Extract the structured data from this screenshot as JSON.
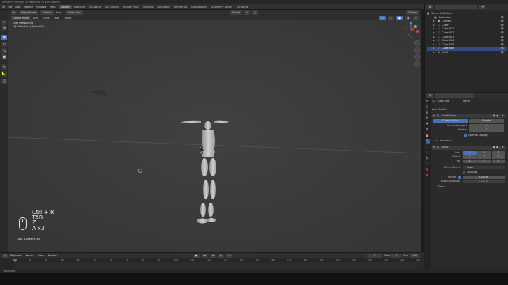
{
  "window": {
    "title": "Blender* [W:\\Rorie to learn\\how to use 1.blend]"
  },
  "menubar": {
    "menus": [
      "File",
      "Edit",
      "Render",
      "Window",
      "Help"
    ],
    "workspaces": [
      "Layout",
      "Modeling",
      "Sculpting",
      "UV Editing",
      "Texture Paint",
      "Shading",
      "Animation",
      "Rendering",
      "Compositing",
      "Geometry Nodes",
      "Scripting"
    ],
    "active_workspace": "Layout",
    "scene_label": "Scene",
    "view_layer_label": "View Layer"
  },
  "viewport_header": {
    "mode": "Object Mode",
    "view": "View",
    "select": "Select",
    "add": "Add",
    "object": "Object",
    "orientation": "Global",
    "transform_orientation_label": "Orientation",
    "default_label": "Default",
    "drag_label": "Drag",
    "select_box": "Select Box",
    "options": "Options"
  },
  "viewport": {
    "view_name": "User Perspective",
    "collection_info": "(1) Collection | Cube.006",
    "key_history": [
      "Ctrl + R",
      "TAB",
      "Z",
      "A x3"
    ],
    "last_operation": "Last: (Deselect) All"
  },
  "outliner": {
    "search_placeholder": "",
    "title": "Scene Collection",
    "items": [
      {
        "label": "Collection",
        "depth": 1,
        "icon": "collection-icon"
      },
      {
        "label": "Camera",
        "depth": 2,
        "icon": "camera-icon"
      },
      {
        "label": "Cube",
        "depth": 2,
        "icon": "mesh-icon"
      },
      {
        "label": "Cube.001",
        "depth": 2,
        "icon": "mesh-icon"
      },
      {
        "label": "Cube.002",
        "depth": 2,
        "icon": "mesh-icon"
      },
      {
        "label": "Cube.003",
        "depth": 2,
        "icon": "mesh-icon"
      },
      {
        "label": "Cube.004",
        "depth": 2,
        "icon": "mesh-icon"
      },
      {
        "label": "Cube.005",
        "depth": 2,
        "icon": "mesh-icon"
      },
      {
        "label": "Cube.006",
        "depth": 2,
        "icon": "mesh-icon"
      },
      {
        "label": "Light",
        "depth": 2,
        "icon": "light-icon"
      }
    ]
  },
  "properties": {
    "object_name": "Cube.006",
    "tab_label": "Mirror",
    "add_modifier": "Add Modifier",
    "subdivision": {
      "name": "Subdivision",
      "catmull_clark": "Catmull-Clark",
      "simple": "Simple",
      "levels_viewport_label": "Levels Viewport",
      "levels_viewport": "1",
      "render_label": "Render",
      "render": "2",
      "optimal_display": "Optimal Display",
      "advanced": "Advanced"
    },
    "mirror": {
      "name": "Mirror",
      "axis_label": "Axis",
      "bisect_label": "Bisect",
      "flip_label": "Flip",
      "x": "X",
      "y": "Y",
      "z": "Z",
      "mirror_object_label": "Mirror Object",
      "mirror_object": "Cube",
      "clipping": "Clipping",
      "merge_label": "Merge",
      "merge_value": "0.001 m",
      "bisect_distance_label": "Bisect Distance",
      "bisect_distance": "0.001 m",
      "data": "Data"
    }
  },
  "timeline": {
    "playback": "Playback",
    "keying": "Keying",
    "view": "View",
    "marker": "Marker",
    "current_frame": "1",
    "start_label": "Start",
    "start": "1",
    "end_label": "End",
    "end": "250",
    "ticks": [
      "0",
      "10",
      "20",
      "30",
      "40",
      "50",
      "60",
      "70",
      "80",
      "90",
      "100",
      "110",
      "120",
      "130",
      "140",
      "150",
      "160",
      "170",
      "180",
      "190",
      "200",
      "210",
      "220",
      "230",
      "240",
      "250"
    ]
  },
  "statusbar": {
    "left": "Pick Shape",
    "right": ""
  },
  "colors": {
    "accent": "#4772b3",
    "viewport_bg": "#3b3b3b",
    "panel_bg": "#2b2b2b"
  }
}
